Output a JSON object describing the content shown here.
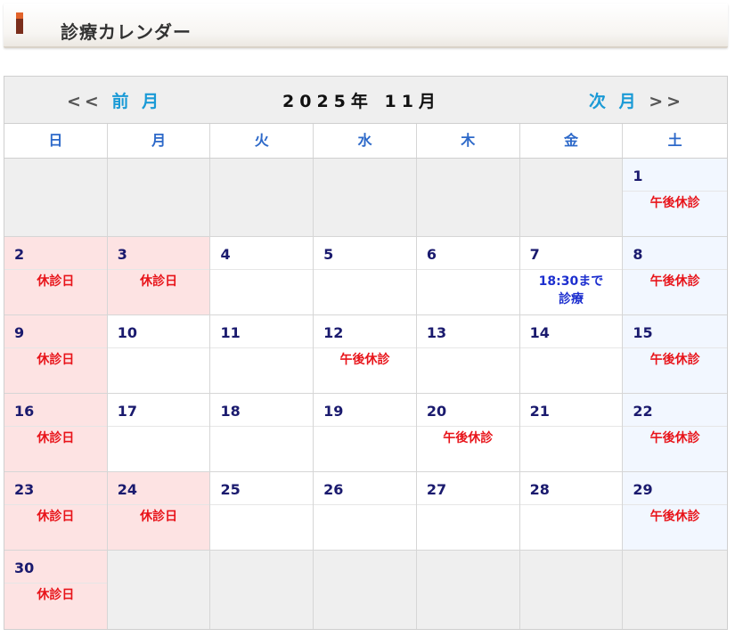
{
  "header": {
    "title": "診療カレンダー"
  },
  "nav": {
    "prev_arrows": "<<",
    "prev_label": "前 月",
    "month_label": "2025年 11月",
    "next_label": "次 月",
    "next_arrows": ">>"
  },
  "weekdays": [
    "日",
    "月",
    "火",
    "水",
    "木",
    "金",
    "土"
  ],
  "colors": {
    "closed": "#e8141a",
    "notice": "#1d2fcf",
    "weekday_header": "#2d69c9",
    "holiday_bg": "#fde3e3"
  },
  "weeks": [
    [
      {
        "day": "",
        "type": "empty",
        "note": ""
      },
      {
        "day": "",
        "type": "empty",
        "note": ""
      },
      {
        "day": "",
        "type": "empty",
        "note": ""
      },
      {
        "day": "",
        "type": "empty",
        "note": ""
      },
      {
        "day": "",
        "type": "empty",
        "note": ""
      },
      {
        "day": "",
        "type": "empty",
        "note": ""
      },
      {
        "day": "1",
        "type": "sat",
        "note": "午後休診",
        "note_color": "red"
      }
    ],
    [
      {
        "day": "2",
        "type": "sun",
        "note": "休診日",
        "note_color": "red"
      },
      {
        "day": "3",
        "type": "holiday",
        "note": "休診日",
        "note_color": "red"
      },
      {
        "day": "4",
        "type": "normal",
        "note": ""
      },
      {
        "day": "5",
        "type": "normal",
        "note": ""
      },
      {
        "day": "6",
        "type": "normal",
        "note": ""
      },
      {
        "day": "7",
        "type": "normal",
        "note": "18:30まで\n診療",
        "note_color": "blue"
      },
      {
        "day": "8",
        "type": "sat",
        "note": "午後休診",
        "note_color": "red"
      }
    ],
    [
      {
        "day": "9",
        "type": "sun",
        "note": "休診日",
        "note_color": "red"
      },
      {
        "day": "10",
        "type": "normal",
        "note": ""
      },
      {
        "day": "11",
        "type": "normal",
        "note": ""
      },
      {
        "day": "12",
        "type": "normal",
        "note": "午後休診",
        "note_color": "red"
      },
      {
        "day": "13",
        "type": "normal",
        "note": ""
      },
      {
        "day": "14",
        "type": "normal",
        "note": ""
      },
      {
        "day": "15",
        "type": "sat",
        "note": "午後休診",
        "note_color": "red"
      }
    ],
    [
      {
        "day": "16",
        "type": "sun",
        "note": "休診日",
        "note_color": "red"
      },
      {
        "day": "17",
        "type": "normal",
        "note": ""
      },
      {
        "day": "18",
        "type": "normal",
        "note": ""
      },
      {
        "day": "19",
        "type": "normal",
        "note": ""
      },
      {
        "day": "20",
        "type": "normal",
        "note": "午後休診",
        "note_color": "red"
      },
      {
        "day": "21",
        "type": "normal",
        "note": ""
      },
      {
        "day": "22",
        "type": "sat",
        "note": "午後休診",
        "note_color": "red"
      }
    ],
    [
      {
        "day": "23",
        "type": "sun",
        "note": "休診日",
        "note_color": "red"
      },
      {
        "day": "24",
        "type": "holiday",
        "note": "休診日",
        "note_color": "red"
      },
      {
        "day": "25",
        "type": "normal",
        "note": ""
      },
      {
        "day": "26",
        "type": "normal",
        "note": ""
      },
      {
        "day": "27",
        "type": "normal",
        "note": ""
      },
      {
        "day": "28",
        "type": "normal",
        "note": ""
      },
      {
        "day": "29",
        "type": "sat",
        "note": "午後休診",
        "note_color": "red"
      }
    ],
    [
      {
        "day": "30",
        "type": "sun",
        "note": "休診日",
        "note_color": "red"
      },
      {
        "day": "",
        "type": "empty",
        "note": ""
      },
      {
        "day": "",
        "type": "empty",
        "note": ""
      },
      {
        "day": "",
        "type": "empty",
        "note": ""
      },
      {
        "day": "",
        "type": "empty",
        "note": ""
      },
      {
        "day": "",
        "type": "empty",
        "note": ""
      },
      {
        "day": "",
        "type": "empty",
        "note": ""
      }
    ]
  ]
}
